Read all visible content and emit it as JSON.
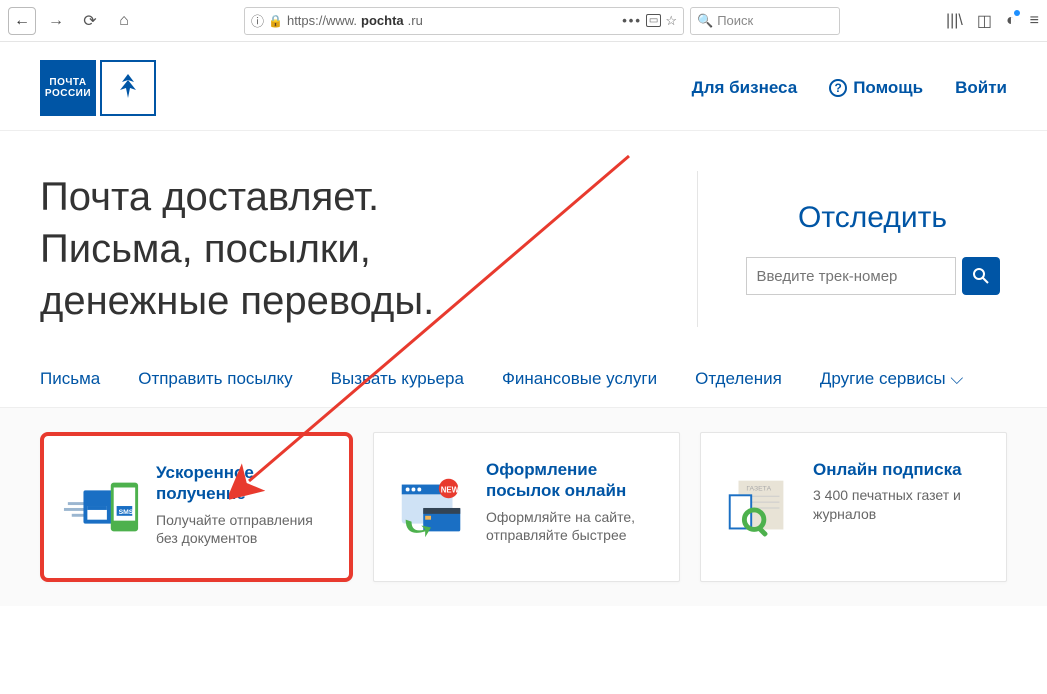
{
  "browser": {
    "url_label": "https://www.",
    "url_domain": "pochta",
    "url_suffix": ".ru",
    "search_placeholder": "Поиск"
  },
  "header": {
    "logo_text": "ПОЧТА\nРОССИИ",
    "link_business": "Для бизнеса",
    "link_help": "Помощь",
    "link_login": "Войти"
  },
  "hero": {
    "line1": "Почта доставляет.",
    "line2": "Письма, посылки,",
    "line3": "денежные переводы.",
    "track_title": "Отследить",
    "track_placeholder": "Введите трек-номер"
  },
  "tabs": {
    "t1": "Письма",
    "t2": "Отправить посылку",
    "t3": "Вызвать курьера",
    "t4": "Финансовые услуги",
    "t5": "Отделения",
    "t6": "Другие сервисы ⌵"
  },
  "cards": [
    {
      "title": "Ускоренное получение",
      "desc": "Получайте отправления без документов"
    },
    {
      "title": "Оформление посылок онлайн",
      "desc": "Оформляйте на сайте, отправляйте быстрее"
    },
    {
      "title": "Онлайн подписка",
      "desc": "3 400 печатных газет и журналов"
    }
  ]
}
